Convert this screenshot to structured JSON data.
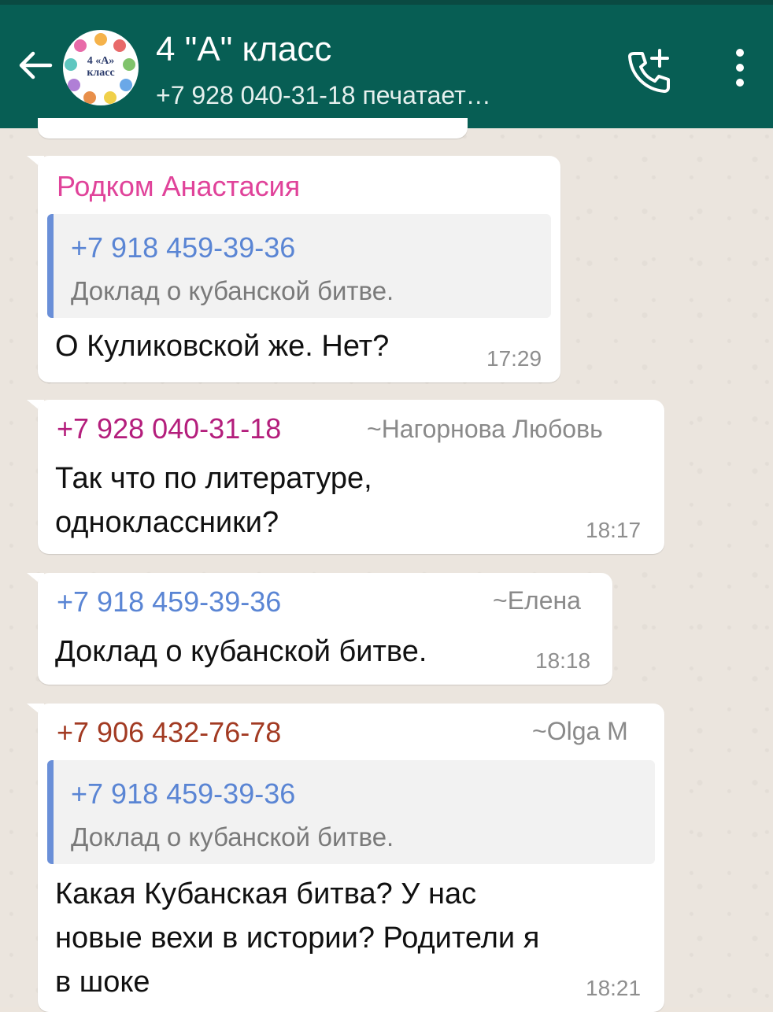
{
  "header": {
    "title": "4 \"А\" класс",
    "subtitle": "+7 928 040-31-18 печатает…",
    "avatar_text_line1": "4 «А»",
    "avatar_text_line2": "класс",
    "icons": [
      "back-arrow-icon",
      "add-call-icon",
      "more-vert-icon"
    ],
    "color": "#075e54"
  },
  "messages": [
    {
      "sender": "Родком Анастасия",
      "sender_color": "#e0439a",
      "quote": {
        "sender": "+7 918 459-39-36",
        "text": "Доклад о кубанской битве."
      },
      "text": "О Куликовской же. Нет?",
      "time": "17:29"
    },
    {
      "sender": "+7 928 040-31-18",
      "sender_color": "#b41e7c",
      "alias": "~Нагорнова Любовь",
      "text_lines": [
        "Так что по литературе,",
        "одноклассники?"
      ],
      "time": "18:17"
    },
    {
      "sender": "+7 918 459-39-36",
      "sender_color": "#5a85d4",
      "alias": "~Елена",
      "text": "Доклад о кубанской битве.",
      "time": "18:18"
    },
    {
      "sender": "+7 906 432-76-78",
      "sender_color": "#a23a22",
      "alias": "~Olga M",
      "quote": {
        "sender": "+7 918 459-39-36",
        "text": "Доклад о кубанской битве."
      },
      "text_lines": [
        "Какая Кубанская битва? У нас",
        "новые вехи в истории? Родители я",
        "в шоке"
      ],
      "time": "18:21"
    }
  ]
}
